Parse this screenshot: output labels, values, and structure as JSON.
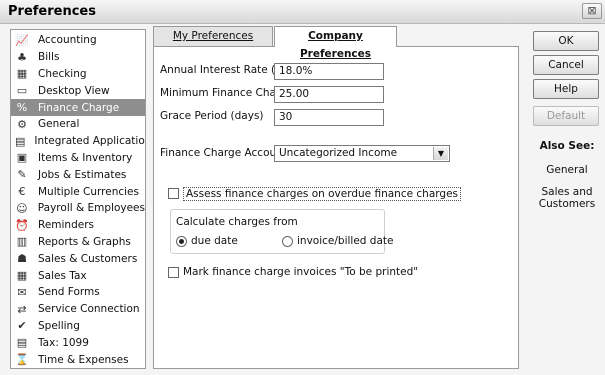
{
  "window": {
    "title": "Preferences",
    "close_glyph": "⊠"
  },
  "sidebar": {
    "items": [
      {
        "label": "Accounting",
        "icon": "📈"
      },
      {
        "label": "Bills",
        "icon": "♣"
      },
      {
        "label": "Checking",
        "icon": "▦"
      },
      {
        "label": "Desktop View",
        "icon": "▭"
      },
      {
        "label": "Finance Charge",
        "icon": "%"
      },
      {
        "label": "General",
        "icon": "⚙"
      },
      {
        "label": "Integrated Applications",
        "icon": "▤"
      },
      {
        "label": "Items & Inventory",
        "icon": "▣"
      },
      {
        "label": "Jobs & Estimates",
        "icon": "✎"
      },
      {
        "label": "Multiple Currencies",
        "icon": "€"
      },
      {
        "label": "Payroll & Employees",
        "icon": "☺"
      },
      {
        "label": "Reminders",
        "icon": "⏰"
      },
      {
        "label": "Reports & Graphs",
        "icon": "▥"
      },
      {
        "label": "Sales & Customers",
        "icon": "☗"
      },
      {
        "label": "Sales Tax",
        "icon": "▦"
      },
      {
        "label": "Send Forms",
        "icon": "✉"
      },
      {
        "label": "Service Connection",
        "icon": "⇄"
      },
      {
        "label": "Spelling",
        "icon": "✔"
      },
      {
        "label": "Tax: 1099",
        "icon": "▤"
      },
      {
        "label": "Time & Expenses",
        "icon": "⌛"
      }
    ]
  },
  "tabs": {
    "my_preferences": "My Preferences",
    "company_preferences": "Company Preferences"
  },
  "form": {
    "annual_interest_rate_label": "Annual Interest Rate (%)",
    "annual_interest_rate_value": "18.0%",
    "minimum_finance_charge_label": "Minimum Finance Charge",
    "minimum_finance_charge_value": "25.00",
    "grace_period_label": "Grace Period (days)",
    "grace_period_value": "30",
    "finance_charge_account_label": "Finance Charge Account",
    "finance_charge_account_value": "Uncategorized Income",
    "assess_overdue_label": "Assess finance charges on overdue finance charges",
    "assess_overdue_checked": false,
    "calculate_from_label": "Calculate charges from",
    "due_date_label": "due date",
    "invoice_billed_date_label": "invoice/billed date",
    "selected_calculation": "due date",
    "mark_to_be_printed_label": "Mark finance charge invoices \"To be printed\"",
    "mark_to_be_printed_checked": false
  },
  "buttons": {
    "ok": "OK",
    "cancel": "Cancel",
    "help": "Help",
    "default": "Default"
  },
  "also_see": {
    "title": "Also See:",
    "links": [
      "General",
      "Sales and Customers"
    ]
  },
  "colors": {
    "selected_item_bg": "#8e8e8e",
    "panel_border": "#9a9a9a"
  }
}
